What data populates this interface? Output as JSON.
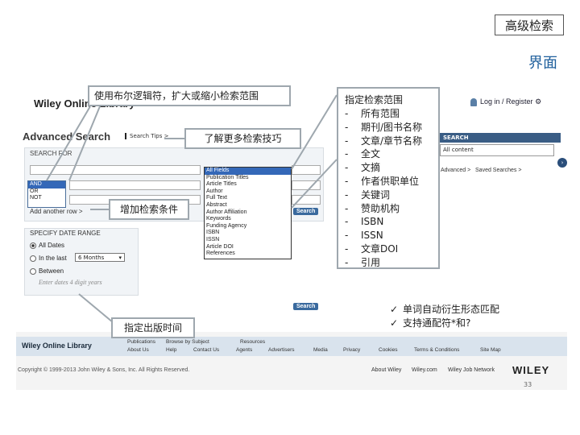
{
  "slide": {
    "title": "高级检索",
    "subtitle": "界面",
    "page_number": "33"
  },
  "site": {
    "brand": "Wiley Online Library",
    "login": "Log in / Register"
  },
  "form": {
    "title": "Advanced Search",
    "search_tips": "Search Tips >",
    "search_for": "SEARCH FOR",
    "bool_options": [
      "AND",
      "OR",
      "NOT"
    ],
    "field_options": [
      "All Fields",
      "Publication Titles",
      "Article Titles",
      "Author",
      "Full Text",
      "Abstract",
      "Author Affiliation",
      "Keywords",
      "Funding Agency",
      "ISBN",
      "ISSN",
      "Article DOI",
      "References"
    ],
    "add_row": "Add another row >",
    "search_button": "Search",
    "date_title": "SPECIFY DATE RANGE",
    "date_all": "All Dates",
    "date_last": "In the last",
    "date_months": "6 Months",
    "date_between": "Between",
    "date_placeholder": "Enter dates 4 digit years"
  },
  "right_panel": {
    "header": "SEARCH",
    "content_select": "All content",
    "advanced_link": "Advanced >",
    "saved_link": "Saved Searches >"
  },
  "footer": {
    "brand": "Wiley Online Library",
    "col1": [
      "Publications",
      "About Us"
    ],
    "col2": [
      "Browse by Subject",
      "Help"
    ],
    "col3": [
      "Resources",
      "Contact Us"
    ],
    "row2_links": [
      "Agents",
      "Advertisers",
      "Media",
      "Privacy",
      "Cookies",
      "Terms & Conditions",
      "Site Map"
    ],
    "copyright": "Copyright © 1999-2013 John Wiley & Sons, Inc. All Rights Reserved.",
    "bottom_links": [
      "About Wiley",
      "Wiley.com",
      "Wiley Job Network"
    ],
    "logo": "WILEY"
  },
  "callouts": {
    "boolean": "使用布尔逻辑符，扩大或缩小检索范围",
    "tips": "了解更多检索技巧",
    "add_row": "增加检索条件",
    "date": "指定出版时间"
  },
  "scope": {
    "title": "指定检索范围",
    "items": [
      "所有范围",
      "期刊/图书名称",
      "文章/章节名称",
      "全文",
      "文摘",
      "作者供职单位",
      "关键词",
      "赞助机构",
      "ISBN",
      "ISSN",
      "文章DOI",
      "引用"
    ]
  },
  "notes": [
    "单词自动衍生形态匹配",
    "支持通配符*和?"
  ],
  "icons": {
    "check": "✓",
    "dash": "-"
  }
}
